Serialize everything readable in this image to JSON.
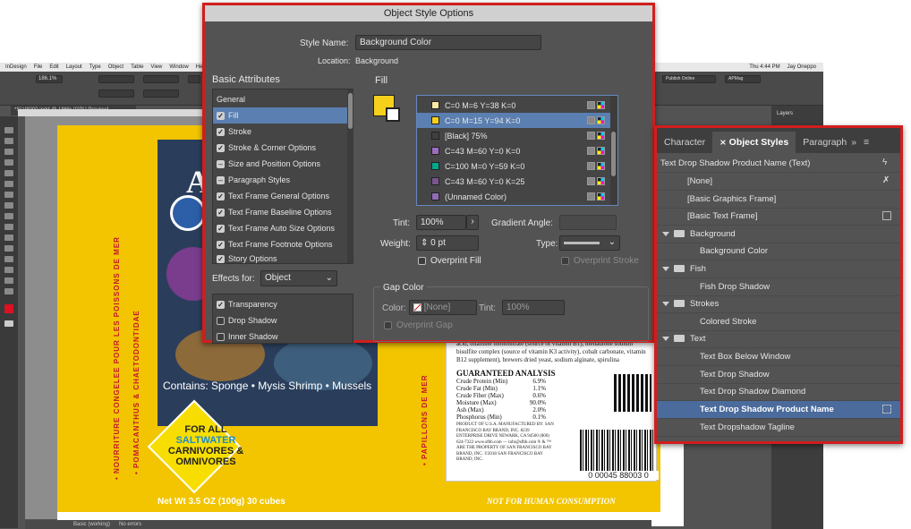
{
  "app": {
    "menu": [
      "InDesign",
      "File",
      "Edit",
      "Layout",
      "Type",
      "Object",
      "Table",
      "View",
      "Window",
      "Help"
    ],
    "clock": "Thu 4:44 PM",
    "user": "Jay Oneppo",
    "zoom": "186.1%",
    "publish": "Publish Online",
    "workspace": "APMag",
    "document_tab": "*SLV8000.indd @ 186% [GPU Preview]",
    "status_page": "Basic (working)",
    "status_errors": "No errors"
  },
  "dialog": {
    "title": "Object Style Options",
    "style_name_label": "Style Name:",
    "style_name_value": "Background Color",
    "location_label": "Location:",
    "location_value": "Background",
    "basic_attributes_header": "Basic Attributes",
    "attributes": [
      {
        "label": "General",
        "state": "none"
      },
      {
        "label": "Fill",
        "state": "checked",
        "selected": true
      },
      {
        "label": "Stroke",
        "state": "checked"
      },
      {
        "label": "Stroke & Corner Options",
        "state": "checked"
      },
      {
        "label": "Size and Position Options",
        "state": "minus"
      },
      {
        "label": "Paragraph Styles",
        "state": "minus"
      },
      {
        "label": "Text Frame General Options",
        "state": "checked"
      },
      {
        "label": "Text Frame Baseline Options",
        "state": "checked"
      },
      {
        "label": "Text Frame Auto Size Options",
        "state": "checked"
      },
      {
        "label": "Text Frame Footnote Options",
        "state": "checked"
      },
      {
        "label": "Story Options",
        "state": "checked"
      }
    ],
    "effects_for_label": "Effects for:",
    "effects_for_value": "Object",
    "effects": [
      {
        "label": "Transparency",
        "state": "checked"
      },
      {
        "label": "Drop Shadow",
        "state": "empty"
      },
      {
        "label": "Inner Shadow",
        "state": "empty"
      }
    ],
    "fill_header": "Fill",
    "swatches": [
      {
        "name": "C=0 M=6 Y=38 K=0",
        "color": "#fde8a3"
      },
      {
        "name": "C=0 M=15 Y=94 K=0",
        "color": "#f7d01c",
        "selected": true
      },
      {
        "name": "[Black] 75%",
        "color": "#404040"
      },
      {
        "name": "C=43 M=60 Y=0 K=0",
        "color": "#9b6cc0"
      },
      {
        "name": "C=100 M=0 Y=59 K=0",
        "color": "#00a88a"
      },
      {
        "name": "C=43 M=60 Y=0 K=25",
        "color": "#7a548f"
      },
      {
        "name": "(Unnamed Color)",
        "color": "#8f6cb8"
      }
    ],
    "tint_label": "Tint:",
    "tint_value": "100%",
    "gradient_angle_label": "Gradient Angle:",
    "weight_label": "Weight:",
    "weight_value": "0 pt",
    "type_label": "Type:",
    "overprint_fill": "Overprint Fill",
    "overprint_stroke": "Overprint Stroke",
    "gap_color_header": "Gap Color",
    "gap_color_label": "Color:",
    "gap_color_value": "[None]",
    "gap_tint_label": "Tint:",
    "gap_tint_value": "100%",
    "overprint_gap": "Overprint Gap"
  },
  "panel": {
    "tabs": [
      "Character",
      "Object Styles",
      "Paragraph"
    ],
    "rows": [
      {
        "label": "Text Drop Shadow Product Name (Text)",
        "indent": 0,
        "kind": "header"
      },
      {
        "label": "[None]",
        "indent": 2,
        "kind": "item"
      },
      {
        "label": "[Basic Graphics Frame]",
        "indent": 2,
        "kind": "item"
      },
      {
        "label": "[Basic Text Frame]",
        "indent": 2,
        "kind": "item"
      },
      {
        "label": "Background",
        "indent": 0,
        "kind": "folder"
      },
      {
        "label": "Background Color",
        "indent": 3,
        "kind": "item"
      },
      {
        "label": "Fish",
        "indent": 0,
        "kind": "folder"
      },
      {
        "label": "Fish Drop Shadow",
        "indent": 3,
        "kind": "item"
      },
      {
        "label": "Strokes",
        "indent": 0,
        "kind": "folder"
      },
      {
        "label": "Colored Stroke",
        "indent": 3,
        "kind": "item"
      },
      {
        "label": "Text",
        "indent": 0,
        "kind": "folder"
      },
      {
        "label": "Text Box Below Window",
        "indent": 3,
        "kind": "item"
      },
      {
        "label": "Text Drop Shadow",
        "indent": 3,
        "kind": "item"
      },
      {
        "label": "Text Drop Shadow Diamond",
        "indent": 3,
        "kind": "item"
      },
      {
        "label": "Text Drop Shadow Product Name",
        "indent": 3,
        "kind": "item",
        "selected": true
      },
      {
        "label": "Text Dropshadow Tagline",
        "indent": 3,
        "kind": "item"
      }
    ]
  },
  "artwork": {
    "contains": "Contains: Sponge • Mysis Shrimp • Mussels",
    "brand_title": "An",
    "diamond_line1": "FOR ALL",
    "diamond_line2": "SALTWATER",
    "diamond_line3": "CARNIVORES &",
    "diamond_line4": "OMNIVORES",
    "vert_left_1": "• NOURRITURE CONGELEE POUR LES POISSONS DE MER",
    "vert_left_2": "• POMACANTHUS & CHAETODONTIDAE",
    "vert_right": "• PAPILLONS DE MER",
    "net_wt": "Net Wt 3.5 OZ (100g) 30 cubes",
    "guaranteed": "GUARANTEED ANALYSIS",
    "analysis": [
      {
        "k": "Crude Protein (Min)",
        "v": "6.9%"
      },
      {
        "k": "Crude Fat (Min)",
        "v": "1.1%"
      },
      {
        "k": "Crude Fiber (Max)",
        "v": "0.6%"
      },
      {
        "k": "Moisture (Max)",
        "v": "90.0%"
      },
      {
        "k": "Ash (Max)",
        "v": "2.0%"
      },
      {
        "k": "Phosphorus (Min)",
        "v": "0.1%"
      }
    ],
    "ingredients": "acid, thiamine mononitrate (source of vitamin B1), menadione sodium bisulfite complex (source of vitamin K3 activity), cobalt carbonate, vitamin B12 supplement), brewers dried yeast, sodium alginate, spirulina",
    "mfr": "PRODUCT OF U.S.A. MANUFACTURED BY: SAN FRANCISCO BAY BRAND, INC. 8239 ENTERPRISE DRIVE NEWARK, CA 94560 (800) 624-7322 www.sfbb.com — info@sfbb.com ® & ™ ARE THE PROPERTY OF SAN FRANCISCO BAY BRAND, INC. ©2018 SAN FRANCISCO BAY BRAND, INC.",
    "barcode_number": "0 00045 88003 0",
    "not_for_human": "NOT FOR HUMAN CONSUMPTION",
    "layers_label": "Layers"
  },
  "colors": {
    "accent_red": "#d21d1d",
    "selection_blue": "#5a7fb0",
    "package_yellow": "#f2c500"
  }
}
